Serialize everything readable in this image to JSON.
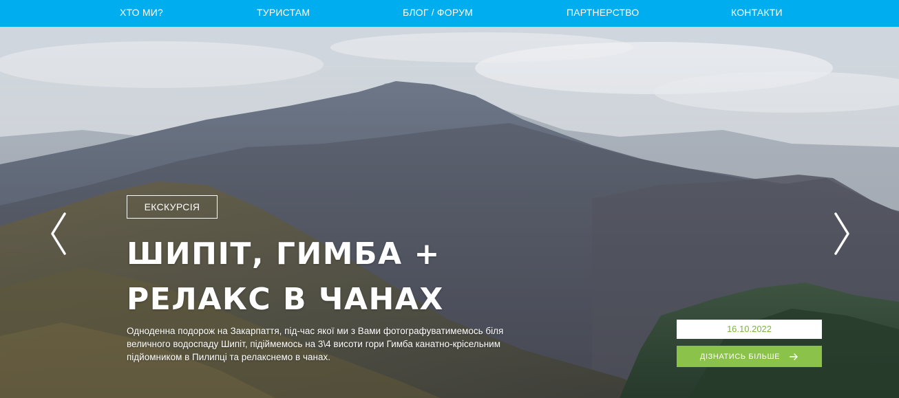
{
  "nav": {
    "items": [
      {
        "label": "ХТО МИ?"
      },
      {
        "label": "ТУРИСТАМ"
      },
      {
        "label": "БЛОГ / ФОРУМ"
      },
      {
        "label": "ПАРТНЕРСТВО"
      },
      {
        "label": "КОНТАКТИ"
      }
    ]
  },
  "slide": {
    "tag": "ЕКСКУРСІЯ",
    "title_line1": "ШИПІТ, ГИМБА +",
    "title_line2": "РЕЛАКС В ЧАНАХ",
    "description": "Одноденна подорож на Закарпаття, під-час якої ми з Вами фотографуватимемось біля величного водоспаду Шипіт, підіймемось на 3\\4 висоти гори Гимба канатно-крісельним підйомником в Пилипці та релакснемо в чанах.",
    "date": "16.10.2022",
    "more_label": "ДІЗНАТИСЬ БІЛЬШЕ"
  },
  "icons": {
    "prev": "chevron-left-icon",
    "next": "chevron-right-icon",
    "button_arrow": "arrow-right-icon"
  },
  "colors": {
    "nav_bg": "#00aeef",
    "button_bg": "#8bc34a",
    "date_text": "#7cb342"
  }
}
